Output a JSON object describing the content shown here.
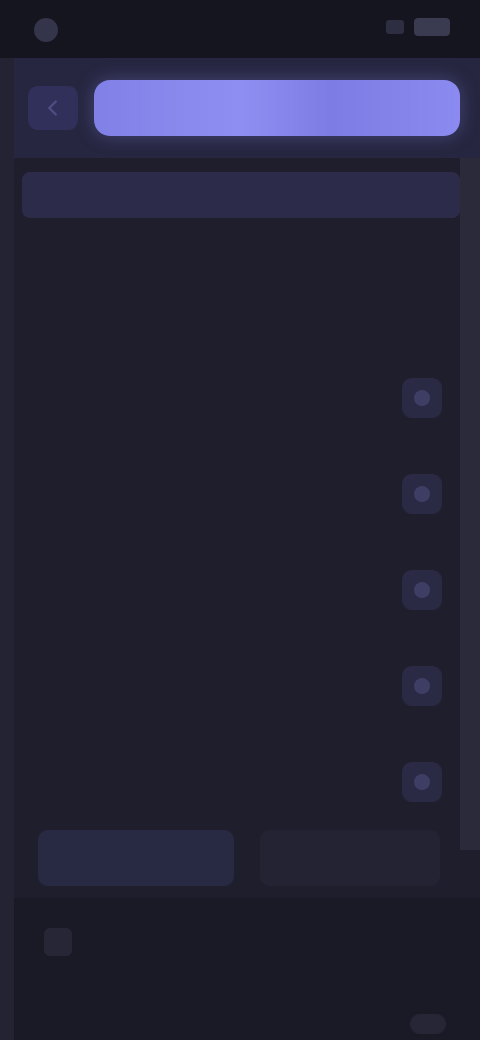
{
  "status": {
    "carrier": "",
    "time": ""
  },
  "header": {
    "title": "",
    "back_label": ""
  },
  "banner": {
    "text": ""
  },
  "section": {
    "label": "",
    "value": ""
  },
  "rows": [
    {
      "title": "",
      "sub": ""
    },
    {
      "title": "",
      "sub": ""
    },
    {
      "title": "",
      "sub": ""
    },
    {
      "title": "",
      "sub": ""
    },
    {
      "title": "",
      "sub": ""
    }
  ],
  "actions": {
    "primary_label": "",
    "secondary_label": ""
  },
  "footer": {
    "title": "",
    "sub": "",
    "link": ""
  },
  "colors": {
    "accent": "#8080e6",
    "background": "#1e1e2c",
    "surface": "#262640"
  },
  "icons": {
    "back": "chevron-left-icon",
    "toggle": "toggle-icon",
    "footer": "app-icon"
  }
}
